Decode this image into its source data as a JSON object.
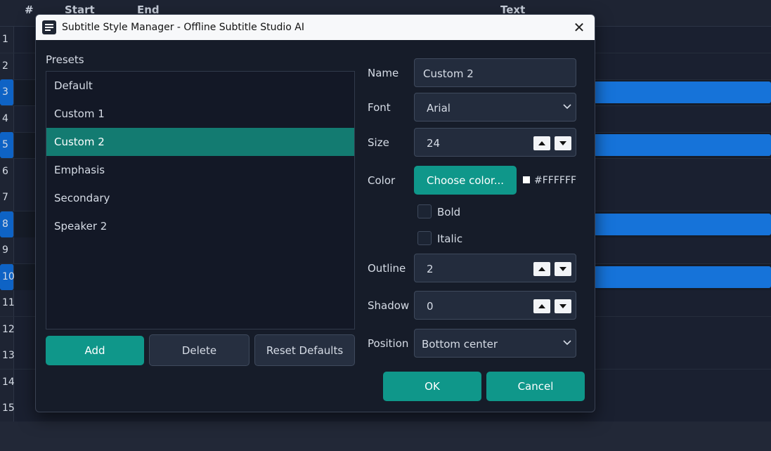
{
  "background_table": {
    "headers": {
      "num": "#",
      "start": "Start",
      "end": "End",
      "text": "Text"
    },
    "rows": [
      {
        "num": "1",
        "selected": false
      },
      {
        "num": "2",
        "selected": false
      },
      {
        "num": "3",
        "selected": true
      },
      {
        "num": "4",
        "selected": false
      },
      {
        "num": "5",
        "selected": true
      },
      {
        "num": "6",
        "selected": false
      },
      {
        "num": "7",
        "selected": false
      },
      {
        "num": "8",
        "selected": true
      },
      {
        "num": "9",
        "selected": false
      },
      {
        "num": "10",
        "selected": true
      },
      {
        "num": "11",
        "selected": false
      },
      {
        "num": "12",
        "selected": false
      },
      {
        "num": "13",
        "selected": false
      },
      {
        "num": "14",
        "selected": false
      },
      {
        "num": "15",
        "selected": false
      }
    ]
  },
  "dialog": {
    "title": "Subtitle Style Manager - Offline Subtitle Studio AI",
    "app_icon": "subtitle-lines-icon",
    "close_icon": "close-icon",
    "close_glyph": "✕"
  },
  "presets": {
    "label": "Presets",
    "selected": "Custom 2",
    "items": [
      "Default",
      "Custom 1",
      "Custom 2",
      "Emphasis",
      "Secondary",
      "Speaker 2"
    ],
    "buttons": {
      "add": "Add",
      "delete": "Delete",
      "reset": "Reset Defaults"
    }
  },
  "form": {
    "name": {
      "label": "Name",
      "value": "Custom 2"
    },
    "font": {
      "label": "Font",
      "value": "Arial"
    },
    "size": {
      "label": "Size",
      "value": "24"
    },
    "color": {
      "label": "Color",
      "button": "Choose color...",
      "hex": "#FFFFFF"
    },
    "bold": {
      "label": "Bold",
      "checked": false
    },
    "italic": {
      "label": "Italic",
      "checked": false
    },
    "outline": {
      "label": "Outline",
      "value": "2"
    },
    "shadow": {
      "label": "Shadow",
      "value": "0"
    },
    "position": {
      "label": "Position",
      "value": "Bottom center"
    }
  },
  "actions": {
    "ok": "OK",
    "cancel": "Cancel"
  },
  "colors": {
    "accent_teal": "#0f978a",
    "selected_preset": "#137b71",
    "selection_blue": "#1673d9",
    "dialog_bg": "#161c29"
  }
}
